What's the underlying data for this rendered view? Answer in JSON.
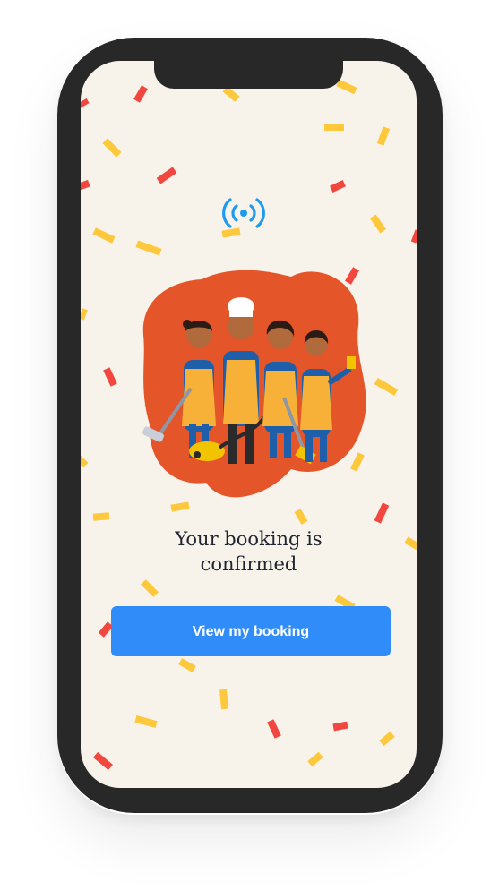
{
  "app": {
    "logo_icon": "signal-broadcast-icon",
    "illustration_icon": "cleaning-team-illustration"
  },
  "confirmation": {
    "title_line1": "Your booking is",
    "title_line2": "confirmed",
    "button_label": "View my booking"
  },
  "colors": {
    "background": "#f8f3ea",
    "accent": "#2f8cf8",
    "illustration_blob": "#e5552a",
    "confetti_red": "#f2473f",
    "confetti_yellow": "#fdc83b",
    "device_frame": "#282828"
  }
}
